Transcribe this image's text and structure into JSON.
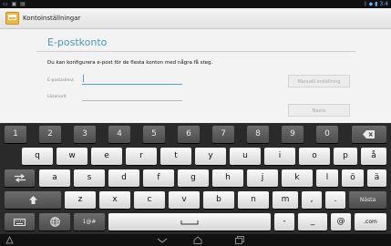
{
  "status_bar": {
    "left_icons": "▭ ▣ ▤",
    "right_text": "ᛒ ◆ ▮ 3:4"
  },
  "action_bar": {
    "title": "Kontoinställningar",
    "icon": "settings-account-icon"
  },
  "content": {
    "heading": "E-postkonto",
    "intro": "Du kan konfigurera e-post för de flesta konton med några få steg.",
    "email_label": "E-postadress",
    "email_value": "",
    "password_label": "Lösenord",
    "password_value": "",
    "manual_setup_button": "Manuell inställning",
    "next_button": "Nästa"
  },
  "keyboard": {
    "number_row": [
      "1",
      "2",
      "3",
      "4",
      "5",
      "6",
      "7",
      "8",
      "9",
      "0"
    ],
    "row_q": [
      "q",
      "w",
      "e",
      "r",
      "t",
      "y",
      "u",
      "i",
      "o",
      "p",
      "å"
    ],
    "row_a": [
      "a",
      "s",
      "d",
      "f",
      "g",
      "h",
      "j",
      "k",
      "l",
      "ö",
      "ä"
    ],
    "row_z": [
      "z",
      "x",
      "c",
      "v",
      "b",
      "n",
      "m",
      ",",
      "."
    ],
    "next_key": "Nästa",
    "symbols_key": "1@#",
    "dash_key": "-",
    "underscore_key": "_",
    "at_key": "@",
    "com_key": ".com",
    "backspace_icon": "backspace-icon",
    "tab_icon": "tab-icon",
    "shift_icon": "shift-icon",
    "keyboard_settings_icon": "keyboard-icon",
    "language_icon": "globe-icon",
    "space_icon": "space-icon"
  },
  "nav_bar": {
    "icons": [
      "notification-icon",
      "back-icon",
      "home-icon",
      "recent-apps-icon"
    ]
  }
}
